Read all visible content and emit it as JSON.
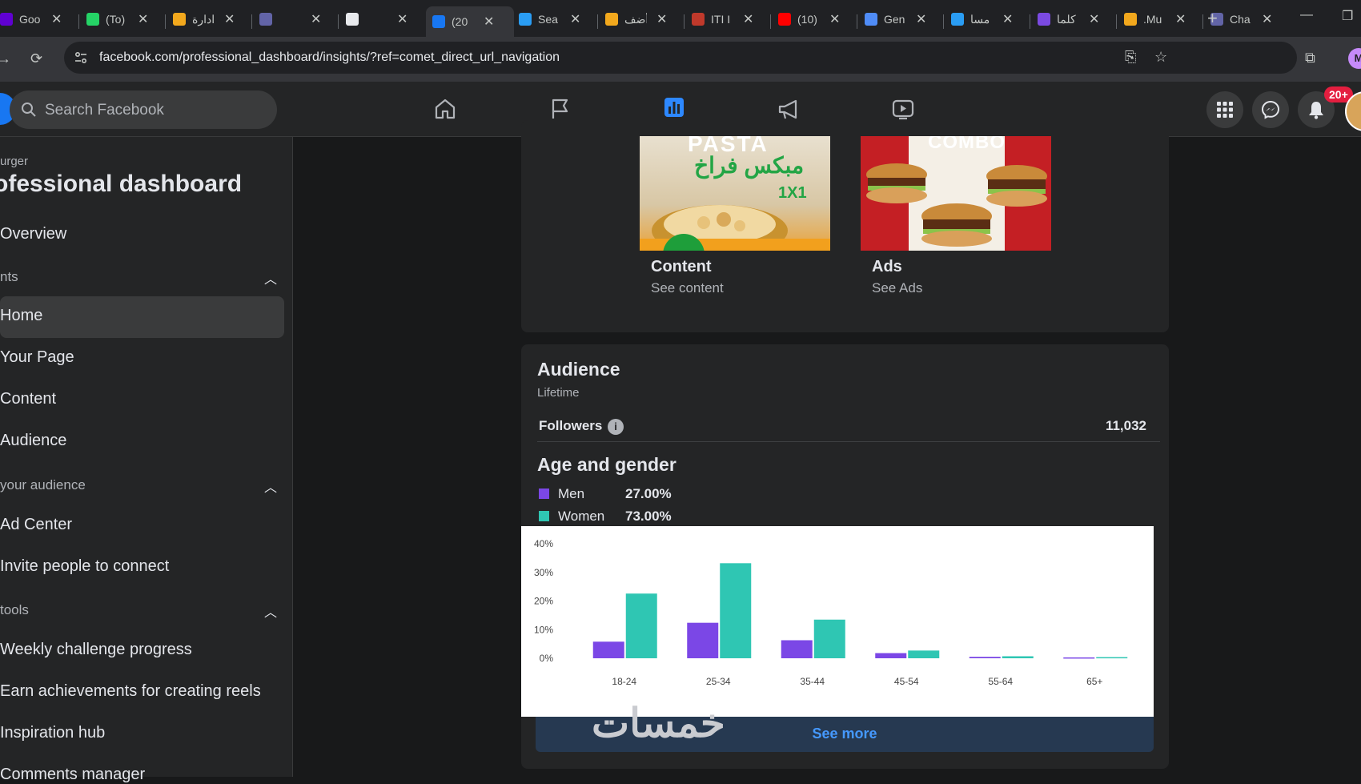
{
  "browser": {
    "tabs": [
      {
        "label": "Goo",
        "icon": "yahoo-icon",
        "color": "#6001d2"
      },
      {
        "label": "(To)",
        "icon": "whatsapp-icon",
        "color": "#25d366"
      },
      {
        "label": "ادارة",
        "icon": "badge-5-icon",
        "color": "#f2a81d"
      },
      {
        "label": "",
        "icon": "teams-icon",
        "color": "#6264a7"
      },
      {
        "label": "",
        "icon": "record-icon",
        "color": "#e8eaed"
      },
      {
        "label": "(20",
        "icon": "facebook-icon",
        "color": "#1877f2"
      },
      {
        "label": "Sea",
        "icon": "copilot-icon",
        "color": "#2a9df4"
      },
      {
        "label": "أضف",
        "icon": "badge-5-icon",
        "color": "#f2a81d"
      },
      {
        "label": "ITI I",
        "icon": "iti-icon",
        "color": "#c0392b"
      },
      {
        "label": "(10)",
        "icon": "youtube-icon",
        "color": "#ff0000"
      },
      {
        "label": "Gen",
        "icon": "gemini-icon",
        "color": "#4f8cf7"
      },
      {
        "label": "مسا",
        "icon": "circle-icon",
        "color": "#2a9df4"
      },
      {
        "label": "كلما",
        "icon": "music-icon",
        "color": "#7b4ae2"
      },
      {
        "label": ".Mu",
        "icon": "badge-5-icon",
        "color": "#f2a81d"
      },
      {
        "label": "Cha",
        "icon": "teams-icon",
        "color": "#6264a7"
      }
    ],
    "url": "facebook.com/professional_dashboard/insights/?ref=comet_direct_url_navigation",
    "profile_initial": "M"
  },
  "fbnav": {
    "search_placeholder": "Search Facebook",
    "notification_badge": "20+"
  },
  "sidebar": {
    "page_name": "urger",
    "title": "ofessional dashboard",
    "overview": "Overview",
    "section_insights": "nts",
    "items_insights": [
      "Home",
      "Your Page",
      "Content",
      "Audience"
    ],
    "section_audience": "your audience",
    "items_audience": [
      "Ad Center",
      "Invite people to connect"
    ],
    "section_tools": "tools",
    "items_tools": [
      "Weekly challenge progress",
      "Earn achievements for creating reels",
      "Inspiration hub",
      "Comments manager"
    ]
  },
  "content_card": {
    "content_title": "Content",
    "content_link": "See content",
    "ads_title": "Ads",
    "ads_link": "See Ads",
    "pasta_text": "مبكس فراخ",
    "pasta_size": "1X1",
    "combo_text": "COMBO",
    "pasta_top": "PASTA"
  },
  "audience": {
    "title": "Audience",
    "subtitle": "Lifetime",
    "followers_label": "Followers",
    "followers_value": "11,032",
    "age_gender_title": "Age and gender",
    "legend": [
      {
        "name": "Men",
        "pct": "27.00%",
        "color": "#7b47e6"
      },
      {
        "name": "Women",
        "pct": "73.00%",
        "color": "#2fc6b3"
      }
    ],
    "see_more": "See more",
    "watermark": "خمسات"
  },
  "chart_data": {
    "type": "bar",
    "categories": [
      "18-24",
      "25-34",
      "35-44",
      "45-54",
      "55-64",
      "65+"
    ],
    "series": [
      {
        "name": "Men",
        "values": [
          5.8,
          12.4,
          6.3,
          1.8,
          0.5,
          0.3
        ],
        "color": "#7b47e6"
      },
      {
        "name": "Women",
        "values": [
          22.6,
          33.2,
          13.5,
          2.7,
          0.7,
          0.4
        ],
        "color": "#2fc6b3"
      }
    ],
    "yticks": [
      "0%",
      "10%",
      "20%",
      "30%",
      "40%"
    ],
    "ylim": [
      0,
      40
    ],
    "legend": "top-left"
  }
}
